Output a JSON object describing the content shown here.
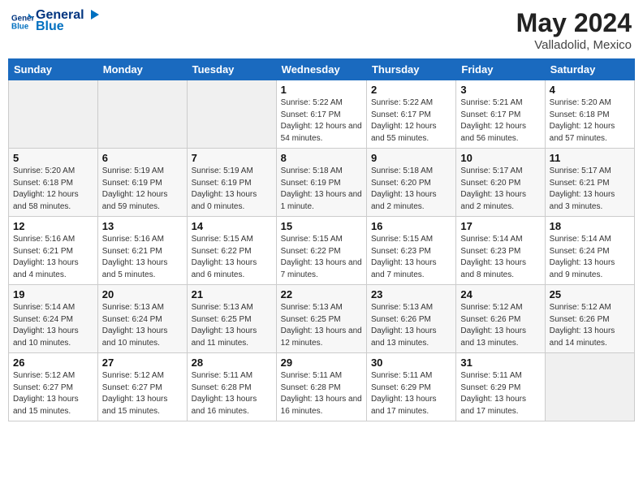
{
  "header": {
    "logo_line1": "General",
    "logo_line2": "Blue",
    "month_year": "May 2024",
    "location": "Valladolid, Mexico"
  },
  "weekdays": [
    "Sunday",
    "Monday",
    "Tuesday",
    "Wednesday",
    "Thursday",
    "Friday",
    "Saturday"
  ],
  "weeks": [
    [
      {
        "day": "",
        "sunrise": "",
        "sunset": "",
        "daylight": ""
      },
      {
        "day": "",
        "sunrise": "",
        "sunset": "",
        "daylight": ""
      },
      {
        "day": "",
        "sunrise": "",
        "sunset": "",
        "daylight": ""
      },
      {
        "day": "1",
        "sunrise": "Sunrise: 5:22 AM",
        "sunset": "Sunset: 6:17 PM",
        "daylight": "Daylight: 12 hours and 54 minutes."
      },
      {
        "day": "2",
        "sunrise": "Sunrise: 5:22 AM",
        "sunset": "Sunset: 6:17 PM",
        "daylight": "Daylight: 12 hours and 55 minutes."
      },
      {
        "day": "3",
        "sunrise": "Sunrise: 5:21 AM",
        "sunset": "Sunset: 6:17 PM",
        "daylight": "Daylight: 12 hours and 56 minutes."
      },
      {
        "day": "4",
        "sunrise": "Sunrise: 5:20 AM",
        "sunset": "Sunset: 6:18 PM",
        "daylight": "Daylight: 12 hours and 57 minutes."
      }
    ],
    [
      {
        "day": "5",
        "sunrise": "Sunrise: 5:20 AM",
        "sunset": "Sunset: 6:18 PM",
        "daylight": "Daylight: 12 hours and 58 minutes."
      },
      {
        "day": "6",
        "sunrise": "Sunrise: 5:19 AM",
        "sunset": "Sunset: 6:19 PM",
        "daylight": "Daylight: 12 hours and 59 minutes."
      },
      {
        "day": "7",
        "sunrise": "Sunrise: 5:19 AM",
        "sunset": "Sunset: 6:19 PM",
        "daylight": "Daylight: 13 hours and 0 minutes."
      },
      {
        "day": "8",
        "sunrise": "Sunrise: 5:18 AM",
        "sunset": "Sunset: 6:19 PM",
        "daylight": "Daylight: 13 hours and 1 minute."
      },
      {
        "day": "9",
        "sunrise": "Sunrise: 5:18 AM",
        "sunset": "Sunset: 6:20 PM",
        "daylight": "Daylight: 13 hours and 2 minutes."
      },
      {
        "day": "10",
        "sunrise": "Sunrise: 5:17 AM",
        "sunset": "Sunset: 6:20 PM",
        "daylight": "Daylight: 13 hours and 2 minutes."
      },
      {
        "day": "11",
        "sunrise": "Sunrise: 5:17 AM",
        "sunset": "Sunset: 6:21 PM",
        "daylight": "Daylight: 13 hours and 3 minutes."
      }
    ],
    [
      {
        "day": "12",
        "sunrise": "Sunrise: 5:16 AM",
        "sunset": "Sunset: 6:21 PM",
        "daylight": "Daylight: 13 hours and 4 minutes."
      },
      {
        "day": "13",
        "sunrise": "Sunrise: 5:16 AM",
        "sunset": "Sunset: 6:21 PM",
        "daylight": "Daylight: 13 hours and 5 minutes."
      },
      {
        "day": "14",
        "sunrise": "Sunrise: 5:15 AM",
        "sunset": "Sunset: 6:22 PM",
        "daylight": "Daylight: 13 hours and 6 minutes."
      },
      {
        "day": "15",
        "sunrise": "Sunrise: 5:15 AM",
        "sunset": "Sunset: 6:22 PM",
        "daylight": "Daylight: 13 hours and 7 minutes."
      },
      {
        "day": "16",
        "sunrise": "Sunrise: 5:15 AM",
        "sunset": "Sunset: 6:23 PM",
        "daylight": "Daylight: 13 hours and 7 minutes."
      },
      {
        "day": "17",
        "sunrise": "Sunrise: 5:14 AM",
        "sunset": "Sunset: 6:23 PM",
        "daylight": "Daylight: 13 hours and 8 minutes."
      },
      {
        "day": "18",
        "sunrise": "Sunrise: 5:14 AM",
        "sunset": "Sunset: 6:24 PM",
        "daylight": "Daylight: 13 hours and 9 minutes."
      }
    ],
    [
      {
        "day": "19",
        "sunrise": "Sunrise: 5:14 AM",
        "sunset": "Sunset: 6:24 PM",
        "daylight": "Daylight: 13 hours and 10 minutes."
      },
      {
        "day": "20",
        "sunrise": "Sunrise: 5:13 AM",
        "sunset": "Sunset: 6:24 PM",
        "daylight": "Daylight: 13 hours and 10 minutes."
      },
      {
        "day": "21",
        "sunrise": "Sunrise: 5:13 AM",
        "sunset": "Sunset: 6:25 PM",
        "daylight": "Daylight: 13 hours and 11 minutes."
      },
      {
        "day": "22",
        "sunrise": "Sunrise: 5:13 AM",
        "sunset": "Sunset: 6:25 PM",
        "daylight": "Daylight: 13 hours and 12 minutes."
      },
      {
        "day": "23",
        "sunrise": "Sunrise: 5:13 AM",
        "sunset": "Sunset: 6:26 PM",
        "daylight": "Daylight: 13 hours and 13 minutes."
      },
      {
        "day": "24",
        "sunrise": "Sunrise: 5:12 AM",
        "sunset": "Sunset: 6:26 PM",
        "daylight": "Daylight: 13 hours and 13 minutes."
      },
      {
        "day": "25",
        "sunrise": "Sunrise: 5:12 AM",
        "sunset": "Sunset: 6:26 PM",
        "daylight": "Daylight: 13 hours and 14 minutes."
      }
    ],
    [
      {
        "day": "26",
        "sunrise": "Sunrise: 5:12 AM",
        "sunset": "Sunset: 6:27 PM",
        "daylight": "Daylight: 13 hours and 15 minutes."
      },
      {
        "day": "27",
        "sunrise": "Sunrise: 5:12 AM",
        "sunset": "Sunset: 6:27 PM",
        "daylight": "Daylight: 13 hours and 15 minutes."
      },
      {
        "day": "28",
        "sunrise": "Sunrise: 5:11 AM",
        "sunset": "Sunset: 6:28 PM",
        "daylight": "Daylight: 13 hours and 16 minutes."
      },
      {
        "day": "29",
        "sunrise": "Sunrise: 5:11 AM",
        "sunset": "Sunset: 6:28 PM",
        "daylight": "Daylight: 13 hours and 16 minutes."
      },
      {
        "day": "30",
        "sunrise": "Sunrise: 5:11 AM",
        "sunset": "Sunset: 6:29 PM",
        "daylight": "Daylight: 13 hours and 17 minutes."
      },
      {
        "day": "31",
        "sunrise": "Sunrise: 5:11 AM",
        "sunset": "Sunset: 6:29 PM",
        "daylight": "Daylight: 13 hours and 17 minutes."
      },
      {
        "day": "",
        "sunrise": "",
        "sunset": "",
        "daylight": ""
      }
    ]
  ]
}
